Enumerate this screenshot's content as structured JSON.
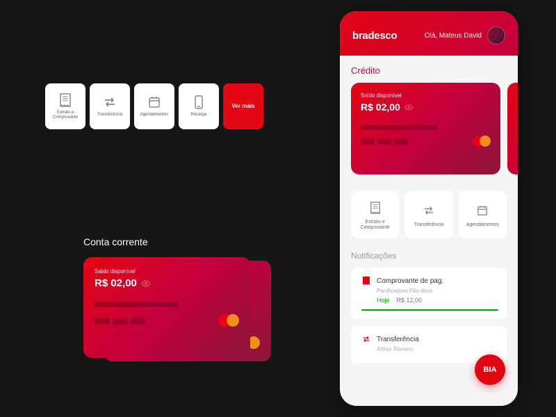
{
  "actions": {
    "extrato": "Extrato e Comprovante",
    "transferencia": "Transferência",
    "agendamentos": "Agendamentos",
    "recarga": "Recarga",
    "vermais": "Ver mais"
  },
  "conta": {
    "title": "Conta corrente",
    "balance_label": "Saldo disponível",
    "balance_amount": "R$ 02,00"
  },
  "phone": {
    "brand": "bradesco",
    "greeting_prefix": "Olá,",
    "greeting_name": "Mateus David",
    "credito_title": "Crédito",
    "card": {
      "balance_label": "Saldo disponível",
      "balance_amount": "R$ 02,00"
    },
    "actions": {
      "extrato": "Extrato e Comprovante",
      "transferencia": "Transferência",
      "agendamentos": "Agendamentos"
    },
    "notif_title": "Notificações",
    "notifs": [
      {
        "title": "Comprovante de pag.",
        "sub": "Panificadora Pão doce",
        "date": "Hoje",
        "amount": "R$ 12,00"
      },
      {
        "title": "Transferência",
        "sub": "Arthur Romero",
        "date": "",
        "amount": ""
      }
    ],
    "bia": "BIA"
  }
}
